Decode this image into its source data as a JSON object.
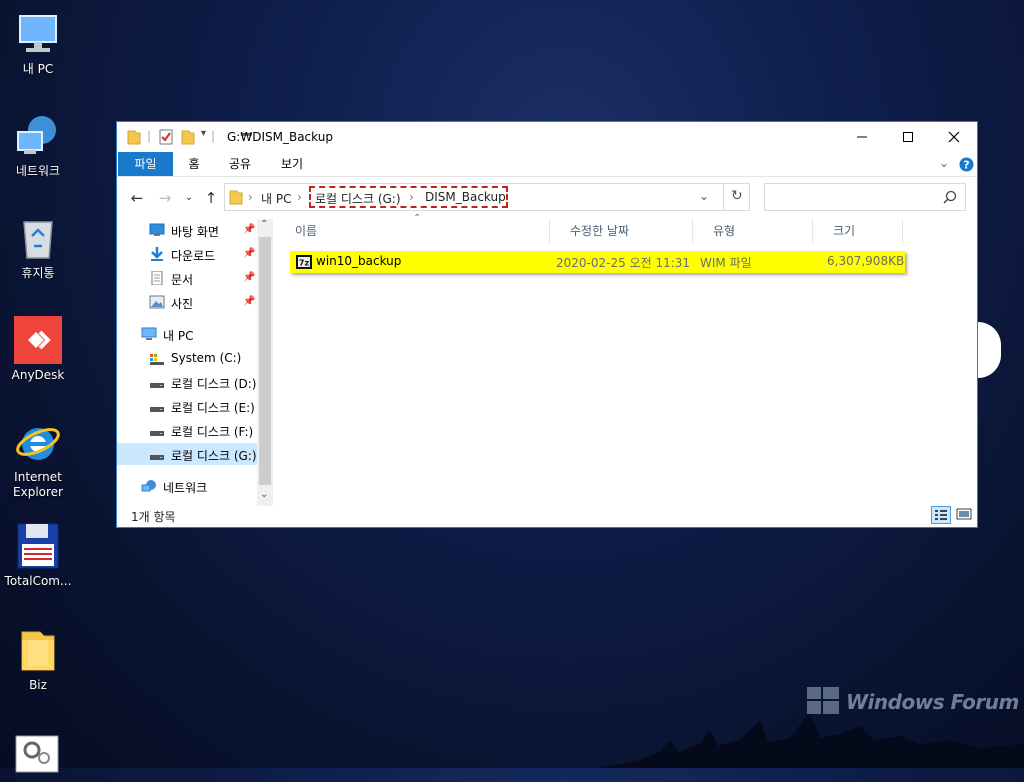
{
  "desktop": {
    "icons": [
      {
        "label": "내 PC",
        "icon": "pc-icon"
      },
      {
        "label": "네트워크",
        "icon": "network-icon"
      },
      {
        "label": "휴지통",
        "icon": "recycle-bin-icon"
      },
      {
        "label": "AnyDesk",
        "icon": "anydesk-icon"
      },
      {
        "label": "Internet Explorer",
        "icon": "ie-icon"
      },
      {
        "label": "TotalCom...",
        "icon": "floppy-icon"
      },
      {
        "label": "Biz",
        "icon": "folder-icon"
      },
      {
        "label": "",
        "icon": "settings-app-icon"
      }
    ],
    "watermark": "Windows Forum"
  },
  "window": {
    "title": "G:₩DISM_Backup",
    "ribbon_tabs": [
      "파일",
      "홈",
      "공유",
      "보기"
    ],
    "address": {
      "crumbs": [
        "내 PC",
        "로컬 디스크 (G:)",
        "DISM_Backup"
      ],
      "search_placeholder": ""
    },
    "nav": {
      "quick_access": [
        {
          "label": "바탕 화면",
          "icon": "desktop-icon",
          "pinned": true
        },
        {
          "label": "다운로드",
          "icon": "download-icon",
          "pinned": true
        },
        {
          "label": "문서",
          "icon": "document-icon",
          "pinned": true
        },
        {
          "label": "사진",
          "icon": "picture-icon",
          "pinned": true
        }
      ],
      "this_pc": "내 PC",
      "drives": [
        {
          "label": "System (C:)",
          "icon": "system-drive-icon"
        },
        {
          "label": "로컬 디스크 (D:)",
          "icon": "drive-icon"
        },
        {
          "label": "로컬 디스크 (E:)",
          "icon": "drive-icon"
        },
        {
          "label": "로컬 디스크 (F:)",
          "icon": "drive-icon"
        },
        {
          "label": "로컬 디스크 (G:)",
          "icon": "drive-icon",
          "selected": true
        }
      ],
      "network": "네트워크"
    },
    "columns": [
      "이름",
      "수정한 날짜",
      "유형",
      "크기"
    ],
    "files": [
      {
        "name": "win10_backup",
        "modified": "2020-02-25 오전 11:31",
        "type": "WIM 파일",
        "size": "6,307,908KB",
        "icon": "7z-archive-icon",
        "highlight": "#ffff00"
      }
    ],
    "status": "1개 항목"
  },
  "colors": {
    "accent": "#1979ca",
    "selection": "#cce8ff",
    "highlight": "#ffff00",
    "dashed_box": "#c42121"
  }
}
